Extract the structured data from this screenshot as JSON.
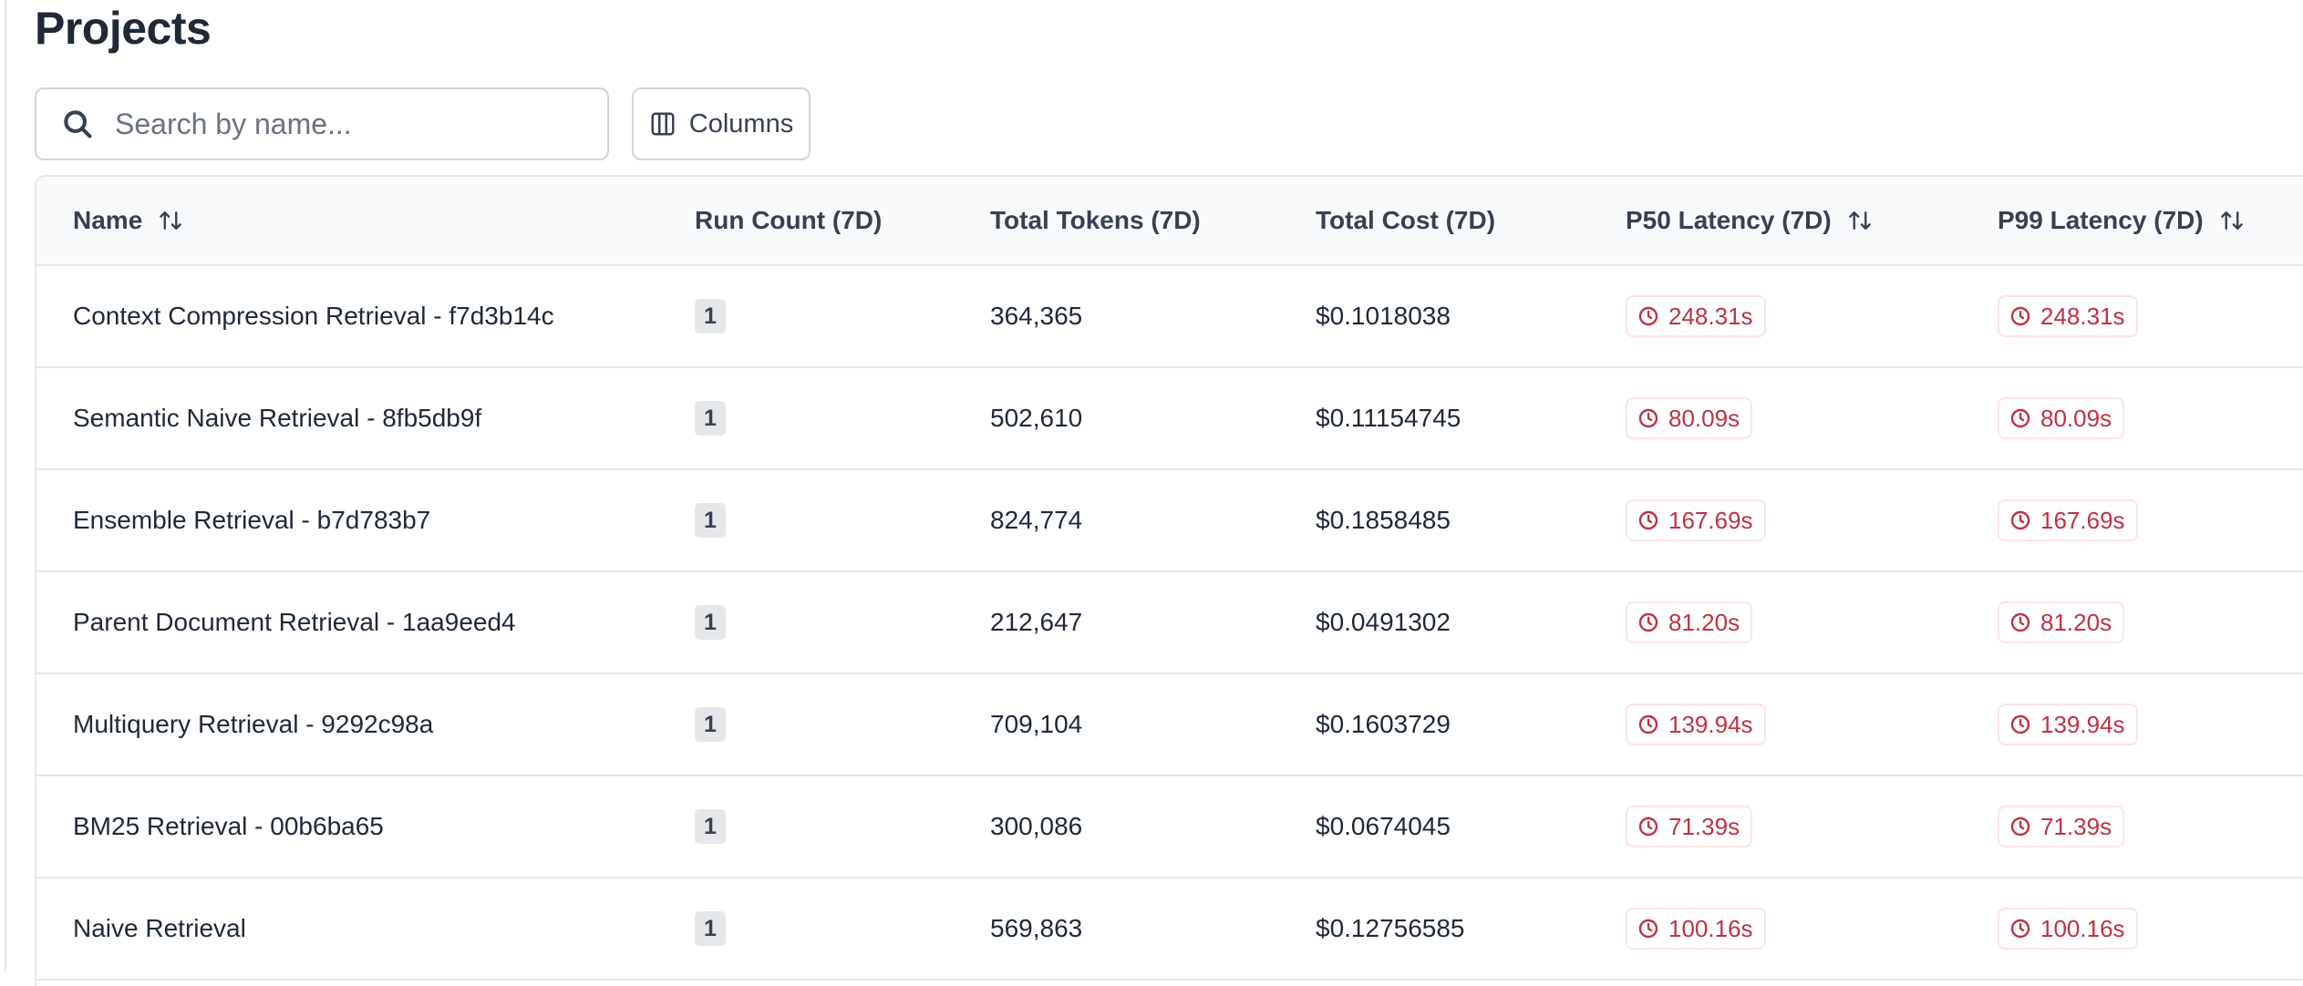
{
  "page": {
    "title": "Projects"
  },
  "toolbar": {
    "search_placeholder": "Search by name...",
    "search_icon": "search-icon",
    "columns_label": "Columns",
    "columns_icon": "columns-icon"
  },
  "table": {
    "headers": {
      "name": "Name",
      "run_count": "Run Count (7D)",
      "total_tokens": "Total Tokens (7D)",
      "total_cost": "Total Cost (7D)",
      "p50_latency": "P50 Latency (7D)",
      "p99_latency": "P99 Latency (7D)"
    },
    "sortable_columns": [
      "name",
      "p50_latency",
      "p99_latency"
    ],
    "rows": [
      {
        "name": "Context Compression Retrieval - f7d3b14c",
        "run_count": "1",
        "total_tokens": "364,365",
        "total_cost": "$0.1018038",
        "p50": "248.31s",
        "p99": "248.31s"
      },
      {
        "name": "Semantic Naive Retrieval - 8fb5db9f",
        "run_count": "1",
        "total_tokens": "502,610",
        "total_cost": "$0.11154745",
        "p50": "80.09s",
        "p99": "80.09s"
      },
      {
        "name": "Ensemble Retrieval - b7d783b7",
        "run_count": "1",
        "total_tokens": "824,774",
        "total_cost": "$0.1858485",
        "p50": "167.69s",
        "p99": "167.69s"
      },
      {
        "name": "Parent Document Retrieval - 1aa9eed4",
        "run_count": "1",
        "total_tokens": "212,647",
        "total_cost": "$0.0491302",
        "p50": "81.20s",
        "p99": "81.20s"
      },
      {
        "name": "Multiquery Retrieval - 9292c98a",
        "run_count": "1",
        "total_tokens": "709,104",
        "total_cost": "$0.1603729",
        "p50": "139.94s",
        "p99": "139.94s"
      },
      {
        "name": "BM25 Retrieval - 00b6ba65",
        "run_count": "1",
        "total_tokens": "300,086",
        "total_cost": "$0.0674045",
        "p50": "71.39s",
        "p99": "71.39s"
      },
      {
        "name": "Naive Retrieval",
        "run_count": "1",
        "total_tokens": "569,863",
        "total_cost": "$0.12756585",
        "p50": "100.16s",
        "p99": "100.16s"
      }
    ]
  },
  "colors": {
    "latency_text": "#be3245",
    "latency_border": "#fbe4e6",
    "badge_bg": "#e5e7eb",
    "header_bg": "#f9fafb"
  }
}
